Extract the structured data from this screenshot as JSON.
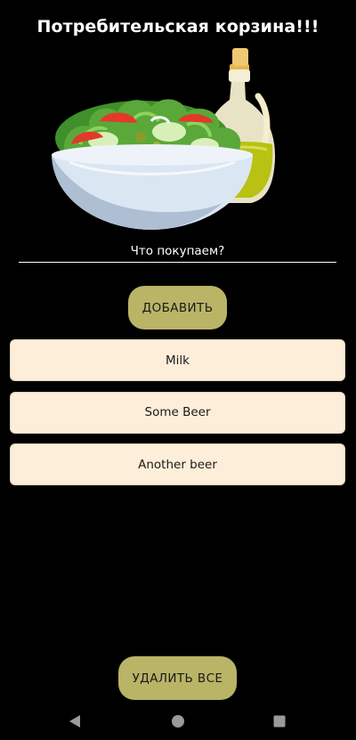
{
  "header": {
    "title": "Потребительская корзина!!!"
  },
  "hero": {
    "image_icon": "salad-bowl-and-oil-bottle-illustration"
  },
  "input": {
    "placeholder": "Что покупаем?",
    "value": ""
  },
  "actions": {
    "add_label": "ДОБАВИТЬ",
    "clear_label": "УДАЛИТЬ ВСЕ"
  },
  "items": [
    {
      "label": "Milk"
    },
    {
      "label": "Some Beer"
    },
    {
      "label": "Another beer"
    }
  ],
  "colors": {
    "background": "#000000",
    "button": "#b9b466",
    "item_background": "#fdeed9"
  },
  "navbar": {
    "back_icon": "back-triangle-icon",
    "home_icon": "home-circle-icon",
    "recent_icon": "recents-square-icon"
  }
}
